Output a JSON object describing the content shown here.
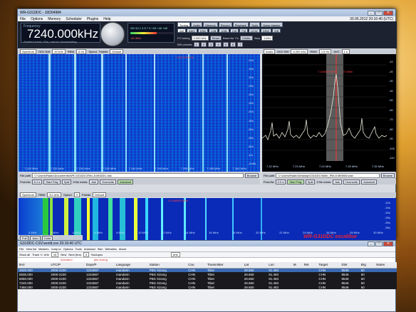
{
  "desktop": {
    "bg": "#e0a030"
  },
  "main_window": {
    "title": "WR-G31DDC - 10D04984",
    "datetime": "30.06.2012 20:16:40 (UTC)",
    "menu": [
      "File",
      "Options",
      "Memory",
      "Scheduler",
      "Plugins",
      "Help"
    ],
    "frequency": "7240.000kHz",
    "freq_label": "Frequency",
    "freq_sub": "Amateur band, 40m, narrow, broadcasting",
    "smeter_scale": "S9+10  1 3 5 7 9 +20 +40 +60",
    "smeter_value": "-82 dBm",
    "top_tabs": [
      "Tuning",
      "Audio",
      "Memory",
      "Record",
      "Playback",
      "Tools",
      "Noise blanker"
    ],
    "modes": [
      "AM",
      "AMS",
      "DSB",
      "LSB",
      "USB",
      "CW",
      "FM",
      "UCW",
      "DRM",
      "ISB"
    ],
    "fo_tuning_label": "FO tuning",
    "fo_tuning_value": "0.000 kHz",
    "reset": "Reset",
    "band_list": "Band list",
    "fs_label": "Fs",
    "center": "Center",
    "step_label": "Step",
    "step_value": "1 kHz",
    "bw_presets": "BW presets",
    "bw_values": [
      "1",
      "2",
      "3",
      "4",
      "5",
      "6",
      "7"
    ],
    "left_panel": {
      "tab": "Spectrum",
      "ddc_bw_label": "DDC BW",
      "ddc_bw": "40 kHz",
      "rbw_label": "RBW",
      "rbw": "6 Hz",
      "speed_label": "Speed",
      "palette_label": "Palette",
      "palette": "Default",
      "marker": "7 240.000 kHz",
      "x_ticks": [
        "7 220 MHz",
        "7 225 MHz",
        "7 230 MHz",
        "7 235 MHz",
        "7 240 MHz",
        "7 245 MHz",
        "7 250 MHz",
        "7 255 MHz",
        "7 260 MHz"
      ],
      "y_ticks": [
        "-10s",
        "-15s",
        "-20s",
        "-25s",
        "-30s",
        "-35s",
        "-40s",
        "-45s",
        "-50s",
        "-55s",
        "-60s",
        "-1m",
        "-1m5s"
      ],
      "file_label": "File path",
      "file_path": "C:\\Users\\Radio\\Documents\\WR-G31DDC\\Rec-8.06\\DDC.ddc",
      "browse": "Browse",
      "proto_label": "Proto/fw",
      "proto_value": "6.1 s",
      "start_play": "Start Play",
      "split": "Split",
      "if_exists": "If file exists:",
      "ask": "Ask",
      "overwrite": "Overwrite",
      "autostart": "Autostart"
    },
    "right_panel": {
      "tab": "Audio",
      "ddc_bw_label": "DDC BW",
      "ddc_bw": "6.000 kHz",
      "rbw_label": "RBW",
      "rbw": "1.5 Hz",
      "avg_label": "AVG",
      "avg": "1 s",
      "marker": "7.240000 MHz",
      "marker_db": "-73 dBm",
      "x_ticks": [
        "7.22 MHz",
        "7.23 MHz",
        "7.24 MHz",
        "7.25 MHz",
        "7.26 MHz"
      ],
      "y_ticks": [
        "-10",
        "-20",
        "-30",
        "-40",
        "-50",
        "-60",
        "-70",
        "-80",
        "-90",
        "-100",
        "-110"
      ],
      "file_label": "File path",
      "file_path": "C:\\Users\\Radio\\Desktop\\G31DDC\\WAV_RW-8.06\\WAV.wav",
      "browse": "Browse",
      "proto_label": "Proto/fw",
      "proto_value": "0.0 s",
      "start_play": "Start Play",
      "split": "Split",
      "if_exists": "If file exists:",
      "ask": "Ask",
      "overwrite": "Overwrite",
      "autostart": "Autostart"
    },
    "wide_panel": {
      "tab": "Spectrum",
      "rbw_label": "RBW",
      "rbw": "8.1 kHz",
      "speed_label": "Speed",
      "speed": "3",
      "palette_label": "Palette",
      "palette": "Default",
      "marker": "11.468000 MHz",
      "x_ticks": [
        "0 MHz",
        "2 MHz",
        "4 MHz",
        "6 MHz",
        "8 MHz",
        "10 MHz",
        "12 MHz",
        "14 MHz",
        "16 MHz",
        "18 MHz",
        "20 MHz",
        "22 MHz",
        "24 MHz",
        "26 MHz",
        "28 MHz",
        "30 MHz"
      ],
      "y_ticks": [
        "-10s",
        "-15s",
        "-20s",
        "-25s",
        "-30s",
        "-35s"
      ],
      "brand": "WR-G31DDC excalibur",
      "footer_btns": [
        "Full",
        "Auto",
        "Color"
      ]
    }
  },
  "db_window": {
    "title": "G31DDC-CSV:world.csv 20:16:40 UTC",
    "menu": [
      "File",
      "View list",
      "Markers",
      "Jump to",
      "Options",
      "Tools",
      "Autoload",
      "Skin",
      "Websites",
      "About"
    ],
    "toolbar": [
      "Show all",
      "Track +/- kHz",
      "15",
      "New",
      "Next (hrs)",
      "0",
      "Nodupes"
    ],
    "filter_unit": "kHz",
    "red_labels": [
      "mandarin",
      "pbs xizang"
    ],
    "columns": [
      "kHz",
      "UTC/P",
      "Days/P",
      "Language",
      "Station",
      "Cou",
      "Transmitter",
      "Lat",
      "Lon",
      "M",
      "kW",
      "Target",
      "Dist",
      "Brg",
      "Notes"
    ],
    "rows": [
      [
        "4920.000",
        "2000-2230",
        "1234567",
        "mandarin",
        "PBS Xizang",
        "CHN",
        "Tibet",
        "29.650",
        "91.483",
        "",
        "",
        "CHN",
        "8546",
        "60",
        ""
      ],
      [
        "5935.000",
        "2000-2230",
        "1234567",
        "mandarin",
        "PBS Xizang",
        "CHN",
        "Tibet",
        "29.650",
        "91.483",
        "",
        "",
        "CHN",
        "8546",
        "60",
        ""
      ],
      [
        "6050.000",
        "2000-2230",
        "1234567",
        "mandarin",
        "PBS Xizang",
        "CHN",
        "Tibet",
        "29.650",
        "91.483",
        "",
        "",
        "CHN",
        "8546",
        "60",
        ""
      ],
      [
        "7240.000",
        "2000-2230",
        "1234567",
        "mandarin",
        "PBS Xizang",
        "CHN",
        "Tibet",
        "29.650",
        "91.483",
        "",
        "",
        "CHN",
        "8546",
        "60",
        ""
      ],
      [
        "7450.000",
        "2000-2230",
        "1234567",
        "mandarin",
        "PBS Xizang",
        "CHN",
        "Tibet",
        "29.650",
        "91.483",
        "",
        "",
        "CHN",
        "8546",
        "60",
        ""
      ]
    ]
  }
}
